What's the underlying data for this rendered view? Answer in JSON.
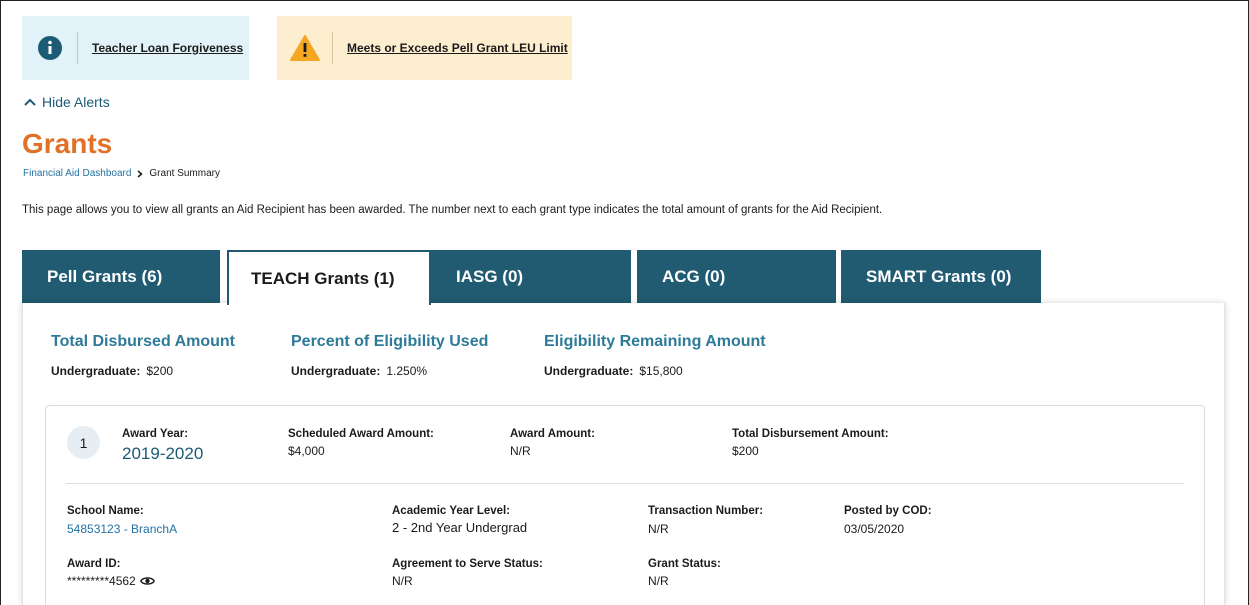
{
  "alerts": {
    "info_label": "Teacher Loan Forgiveness",
    "warn_label": "Meets or Exceeds Pell Grant LEU Limit",
    "hide_label": "Hide Alerts"
  },
  "page": {
    "title": "Grants",
    "intro": "This page allows you to view all grants an Aid Recipient has been awarded. The number next to each grant type indicates the total amount of grants for the Aid Recipient."
  },
  "breadcrumb": {
    "parent": "Financial Aid Dashboard",
    "current": "Grant Summary"
  },
  "tabs": [
    {
      "label": "Pell Grants (6)",
      "active": false
    },
    {
      "label": "TEACH Grants (1)",
      "active": true
    },
    {
      "label": "IASG (0)",
      "active": false
    },
    {
      "label": "ACG (0)",
      "active": false
    },
    {
      "label": "SMART Grants (0)",
      "active": false
    }
  ],
  "summary": {
    "total_disbursed": {
      "heading": "Total Disbursed Amount",
      "label": "Undergraduate:",
      "value": "$200"
    },
    "percent_used": {
      "heading": "Percent of Eligibility Used",
      "label": "Undergraduate:",
      "value": "1.250%"
    },
    "remaining": {
      "heading": "Eligibility Remaining Amount",
      "label": "Undergraduate:",
      "value": "$15,800"
    }
  },
  "award": {
    "number": "1",
    "award_year_label": "Award Year:",
    "award_year": "2019-2020",
    "scheduled_label": "Scheduled Award Amount:",
    "scheduled": "$4,000",
    "award_amount_label": "Award Amount:",
    "award_amount": "N/R",
    "total_disb_label": "Total Disbursement Amount:",
    "total_disb": "$200",
    "school_label": "School Name:",
    "school": "54853123 - BranchA",
    "acad_label": "Academic Year Level:",
    "acad": "2 - 2nd Year Undergrad",
    "txn_label": "Transaction Number:",
    "txn": "N/R",
    "posted_label": "Posted by COD:",
    "posted": "03/05/2020",
    "award_id_label": "Award ID:",
    "award_id": "*********4562",
    "ats_label": "Agreement to Serve Status:",
    "ats": "N/R",
    "grant_status_label": "Grant Status:",
    "grant_status": "N/R"
  },
  "colors": {
    "tab_bg": "#205b71",
    "title_orange": "#e07127",
    "info_bg": "#e1f3f8",
    "warn_bg": "#fdeed0",
    "link_blue": "#2372a3"
  },
  "icons": {
    "info": "info-circle-icon",
    "warn": "warning-triangle-icon",
    "hide": "chevron-up-icon",
    "breadcrumb_sep": "chevron-right-icon",
    "award_id": "eye-icon"
  }
}
